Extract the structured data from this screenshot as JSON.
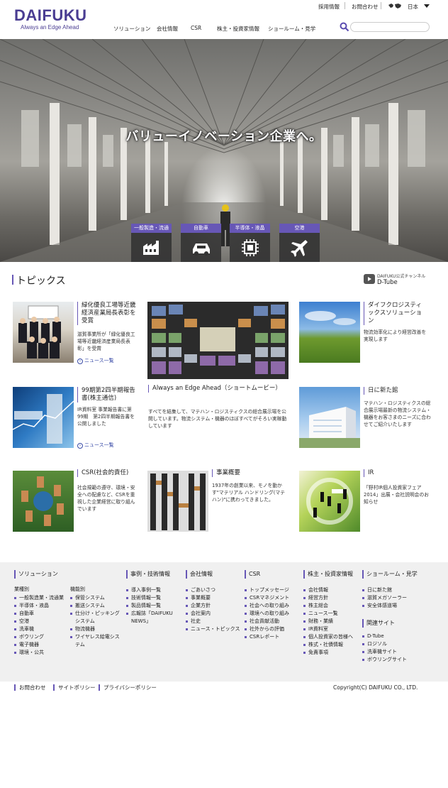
{
  "header": {
    "logo_text": "DAIFUKU",
    "tagline": "Always an Edge Ahead",
    "util_links": [
      "採用情報",
      "お問合わせ"
    ],
    "language": "日本",
    "nav": [
      "ソリューション",
      "会社情報",
      "CSR",
      "株主・投資家情報",
      "ショールーム・見学"
    ],
    "search_placeholder": ""
  },
  "hero": {
    "headline": "バリューイノベーション企業へ。",
    "categories": [
      {
        "label": "一般製造・流通",
        "icon": "factory-icon"
      },
      {
        "label": "自動車",
        "icon": "car-icon"
      },
      {
        "label": "半導体・液晶",
        "icon": "chip-icon"
      },
      {
        "label": "空港",
        "icon": "airplane-icon"
      }
    ]
  },
  "topics": {
    "title": "トピックス",
    "dtube_sub": "DAIFUKU公式チャンネル",
    "dtube_name": "D-Tube",
    "items": [
      {
        "title": "緑化優良工場等近畿経済産業局長表彰を受賞",
        "desc": "滋賀事業所が「緑化優良工場等近畿経済産業局長表彰」を受賞",
        "more": "ニュース一覧"
      },
      {
        "title": "Always an Edge Ahead（ショートムービー）",
        "desc": "すべてを結集して、マテハン・ロジスティクスの総合展示場を公開しています。物流システム・機器のほぼすべてがそろい実稼動しています"
      },
      {
        "title": "ダイフクロジスティックスソリューション",
        "desc": "物流効率化により経営改善を実現します"
      },
      {
        "title": "99期第2四半期報告書(株主通信)",
        "desc": "IR資料室 事業報告書に第99期　第2四半期報告書を公開しました",
        "more": "ニュース一覧"
      },
      {
        "title": "日に新た館",
        "desc": "マテハン・ロジスティクスの総合展示場最新の物流システム・機器をお客さまのニーズに合わせてご紹介いたします"
      },
      {
        "title": "CSR(社会的責任)",
        "desc": "社会規範の遵守、環境・安全への配慮など、CSRを重視した企業経営に取り組んでいます"
      },
      {
        "title": "事業概要",
        "desc": "1937年の創業以来、モノを動かす\"マテリアル ハンドリング(マテハン)\"に携わってきました。"
      },
      {
        "title": "IR",
        "desc": "「野村IR個人投資家フェア2014」出展・会社説明会のお知らせ"
      }
    ]
  },
  "footer": {
    "solutions": {
      "title": "ソリューション",
      "industry_label": "業種別",
      "industry": [
        "一般製造業・流通業",
        "半導体・液晶",
        "自動車",
        "空港",
        "洗車機",
        "ボウリング",
        "電子機器",
        "環境・公共"
      ],
      "function_label": "機能別",
      "function": [
        "保管システム",
        "搬送システム",
        "仕分け・ピッキングシステム",
        "物流機器",
        "ワイヤレス給電システム"
      ]
    },
    "cases": {
      "title": "事例・技術情報",
      "items": [
        "導入事例一覧",
        "技術情報一覧",
        "製品情報一覧",
        "広報誌「DAIFUKU NEWS」"
      ]
    },
    "company": {
      "title": "会社情報",
      "items": [
        "ごあいさつ",
        "事業概要",
        "企業方針",
        "会社案内",
        "社史",
        "ニュース・トピックス"
      ]
    },
    "csr": {
      "title": "CSR",
      "items": [
        "トップメッセージ",
        "CSRマネジメント",
        "社会への取り組み",
        "環境への取り組み",
        "社会貢献活動",
        "社外からの評価",
        "CSRレポート"
      ]
    },
    "ir": {
      "title": "株主・投資家情報",
      "items": [
        "会社情報",
        "経営方針",
        "株主総会",
        "ニュース一覧",
        "財務・業績",
        "IR資料室",
        "個人投資家の皆様へ",
        "株式・社債情報",
        "免責事項"
      ]
    },
    "showroom": {
      "title": "ショールーム・見学",
      "items": [
        "日に新た館",
        "滋賀メガソーラー",
        "安全体感道場"
      ]
    },
    "related": {
      "title": "関連サイト",
      "items": [
        "D-Tube",
        "ロジソル",
        "洗車機サイト",
        "ボウリングサイト"
      ]
    }
  },
  "bottom": {
    "links": [
      "お問合わせ",
      "サイトポリシー",
      "プライバシーポリシー"
    ],
    "copyright": "Copyright(C) DAIFUKU CO., LTD."
  }
}
